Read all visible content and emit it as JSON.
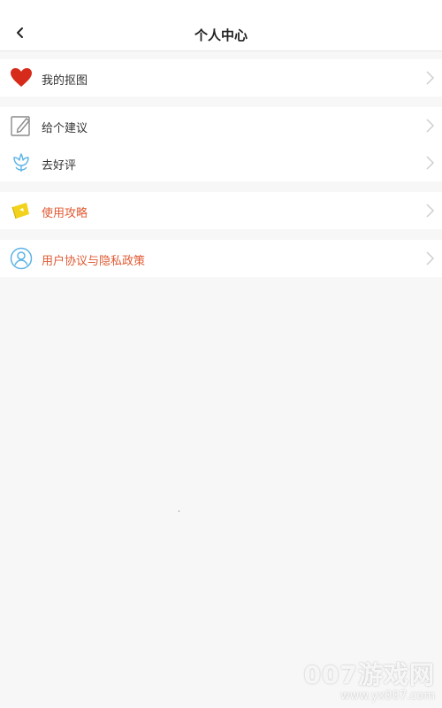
{
  "header": {
    "title": "个人中心"
  },
  "menu": {
    "group1": [
      {
        "label": "我的抠图",
        "icon": "heart-icon"
      }
    ],
    "group2": [
      {
        "label": "给个建议",
        "icon": "pencil-edit-icon"
      },
      {
        "label": "去好评",
        "icon": "flower-icon"
      }
    ],
    "group3": [
      {
        "label": "使用攻略",
        "icon": "guide-kite-icon"
      }
    ],
    "group4": [
      {
        "label": "用户协议与隐私政策",
        "icon": "user-profile-icon"
      }
    ]
  },
  "colors": {
    "accent_text": "#e05a33",
    "heart": "#d62a1a",
    "guide_yellow": "#f2d21b",
    "user_blue": "#5cb3e6"
  },
  "watermark": {
    "title": "007游戏网",
    "url": "www.yx007.com"
  }
}
